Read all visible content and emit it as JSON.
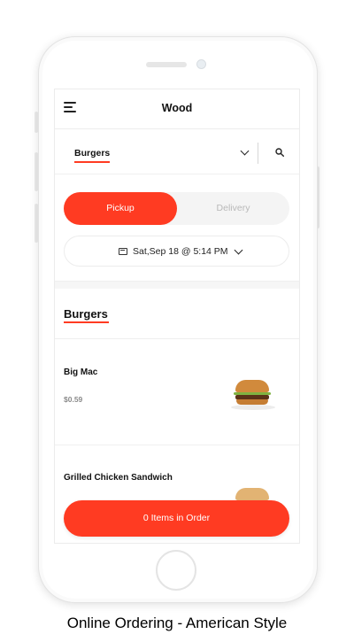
{
  "header": {
    "title": "Wood",
    "menu_icon": "hamburger-menu-icon"
  },
  "category_selector": {
    "selected": "Burgers",
    "dropdown_icon": "chevron-down-icon",
    "search_icon": "search-icon"
  },
  "order_type": {
    "options": [
      "Pickup",
      "Delivery"
    ],
    "selected": "Pickup"
  },
  "schedule": {
    "datetime": "Sat,Sep 18 @ 5:14 PM",
    "icon": "calendar-icon"
  },
  "menu_section": {
    "title": "Burgers",
    "items": [
      {
        "name": "Big Mac",
        "price": "$0.59"
      },
      {
        "name": "Grilled Chicken Sandwich"
      }
    ]
  },
  "order_button": {
    "label": "0 Items in Order"
  },
  "caption": "Online Ordering - American Style",
  "colors": {
    "accent": "#ff3b22",
    "muted": "#b9b9b9"
  }
}
